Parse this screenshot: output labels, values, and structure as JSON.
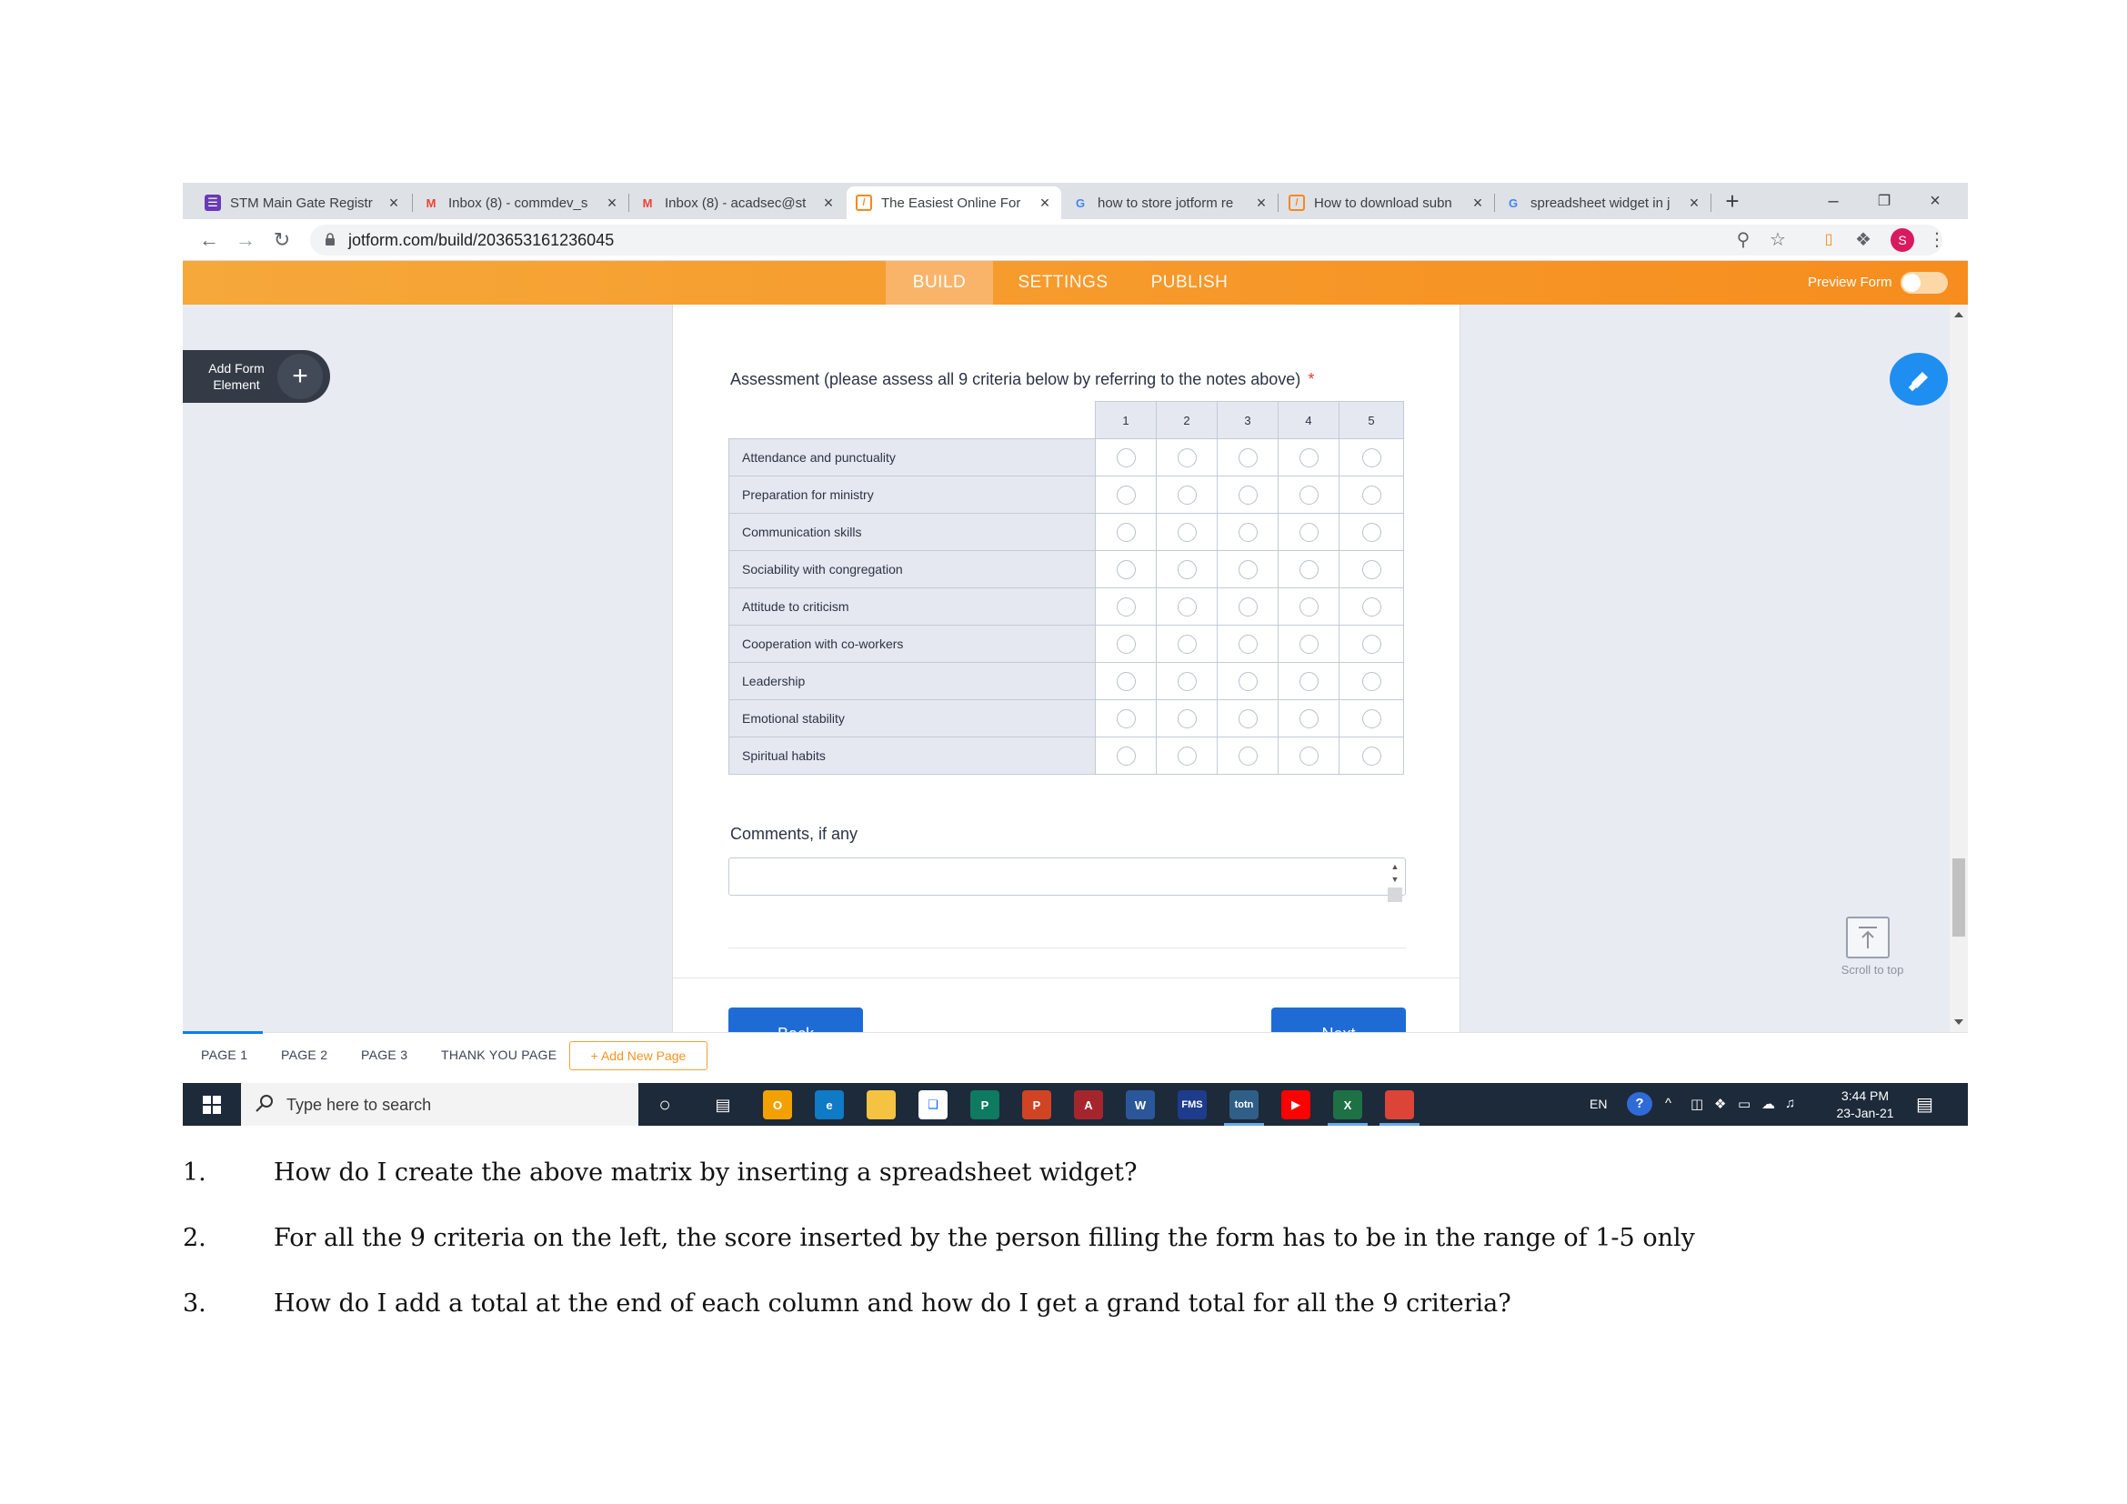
{
  "browser": {
    "tabs": [
      {
        "title": "STM Main Gate Registr",
        "favicon": "forms-icon",
        "color": "#673ab7"
      },
      {
        "title": "Inbox (8) - commdev_s",
        "favicon": "gmail-icon",
        "color": "#ea4335"
      },
      {
        "title": "Inbox (8) - acadsec@st",
        "favicon": "gmail-icon",
        "color": "#ea4335"
      },
      {
        "title": "The Easiest Online For",
        "favicon": "jotform-icon",
        "color": "#f6891f"
      },
      {
        "title": "how to store jotform re",
        "favicon": "google-icon",
        "color": "#4285f4"
      },
      {
        "title": "How to download subn",
        "favicon": "jotform-icon",
        "color": "#f6891f"
      },
      {
        "title": "spreadsheet widget in j",
        "favicon": "google-icon",
        "color": "#4285f4"
      }
    ],
    "url": "jotform.com/build/203653161236045",
    "profile_initial": "S"
  },
  "jotform": {
    "nav": [
      "BUILD",
      "SETTINGS",
      "PUBLISH"
    ],
    "preview_label": "Preview Form",
    "add_element": "Add Form Element",
    "scroll_to_top": "Scroll to top",
    "accent": "#f68d1e"
  },
  "form": {
    "question": "Assessment (please assess all 9 criteria below by referring to the notes above)",
    "required_mark": "*",
    "columns": [
      "1",
      "2",
      "3",
      "4",
      "5"
    ],
    "criteria": [
      "Attendance and punctuality",
      "Preparation for ministry",
      "Communication skills",
      "Sociability with congregation",
      "Attitude to criticism",
      "Cooperation with co-workers",
      "Leadership",
      "Emotional stability",
      "Spiritual habits"
    ],
    "comments_label": "Comments, if any",
    "back_label": "Back",
    "next_label": "Next"
  },
  "pages": {
    "tabs": [
      "PAGE 1",
      "PAGE 2",
      "PAGE 3",
      "THANK YOU PAGE"
    ],
    "add_label": "+ Add New Page"
  },
  "taskbar": {
    "search_placeholder": "Type here to search",
    "lang": "EN",
    "time": "3:44 PM",
    "date": "23-Jan-21",
    "apps": [
      {
        "name": "outlook-icon",
        "label": "O",
        "color": "#f2a100"
      },
      {
        "name": "edge-icon",
        "label": "e",
        "color": "#0f7ac6"
      },
      {
        "name": "file-explorer-icon",
        "label": "",
        "color": "#f5c242"
      },
      {
        "name": "dropbox-icon",
        "label": "❑",
        "color": "#ffffff"
      },
      {
        "name": "publisher-icon",
        "label": "P",
        "color": "#0e7a5f"
      },
      {
        "name": "powerpoint-icon",
        "label": "P",
        "color": "#d04423"
      },
      {
        "name": "access-icon",
        "label": "A",
        "color": "#a4262c"
      },
      {
        "name": "word-icon",
        "label": "W",
        "color": "#2b579a"
      },
      {
        "name": "fms-icon",
        "label": "FMS",
        "color": "#1e3c8c"
      },
      {
        "name": "totn-icon",
        "label": "totn",
        "color": "#2f5f86"
      },
      {
        "name": "youtube-icon",
        "label": "▶",
        "color": "#ff0000"
      },
      {
        "name": "excel-icon",
        "label": "X",
        "color": "#1e7145"
      },
      {
        "name": "chrome-icon",
        "label": "",
        "color": "#db4437"
      }
    ]
  },
  "questions": [
    {
      "num": "1.",
      "text": "How do I create the above matrix by inserting a spreadsheet widget?"
    },
    {
      "num": "2.",
      "text": "For all the 9 criteria on the left, the score inserted by the person filling the form has to be in the range of 1-5 only"
    },
    {
      "num": "3.",
      "text": "How do I add a total at the end of each column and how do I get a grand total for all the 9 criteria?"
    }
  ]
}
